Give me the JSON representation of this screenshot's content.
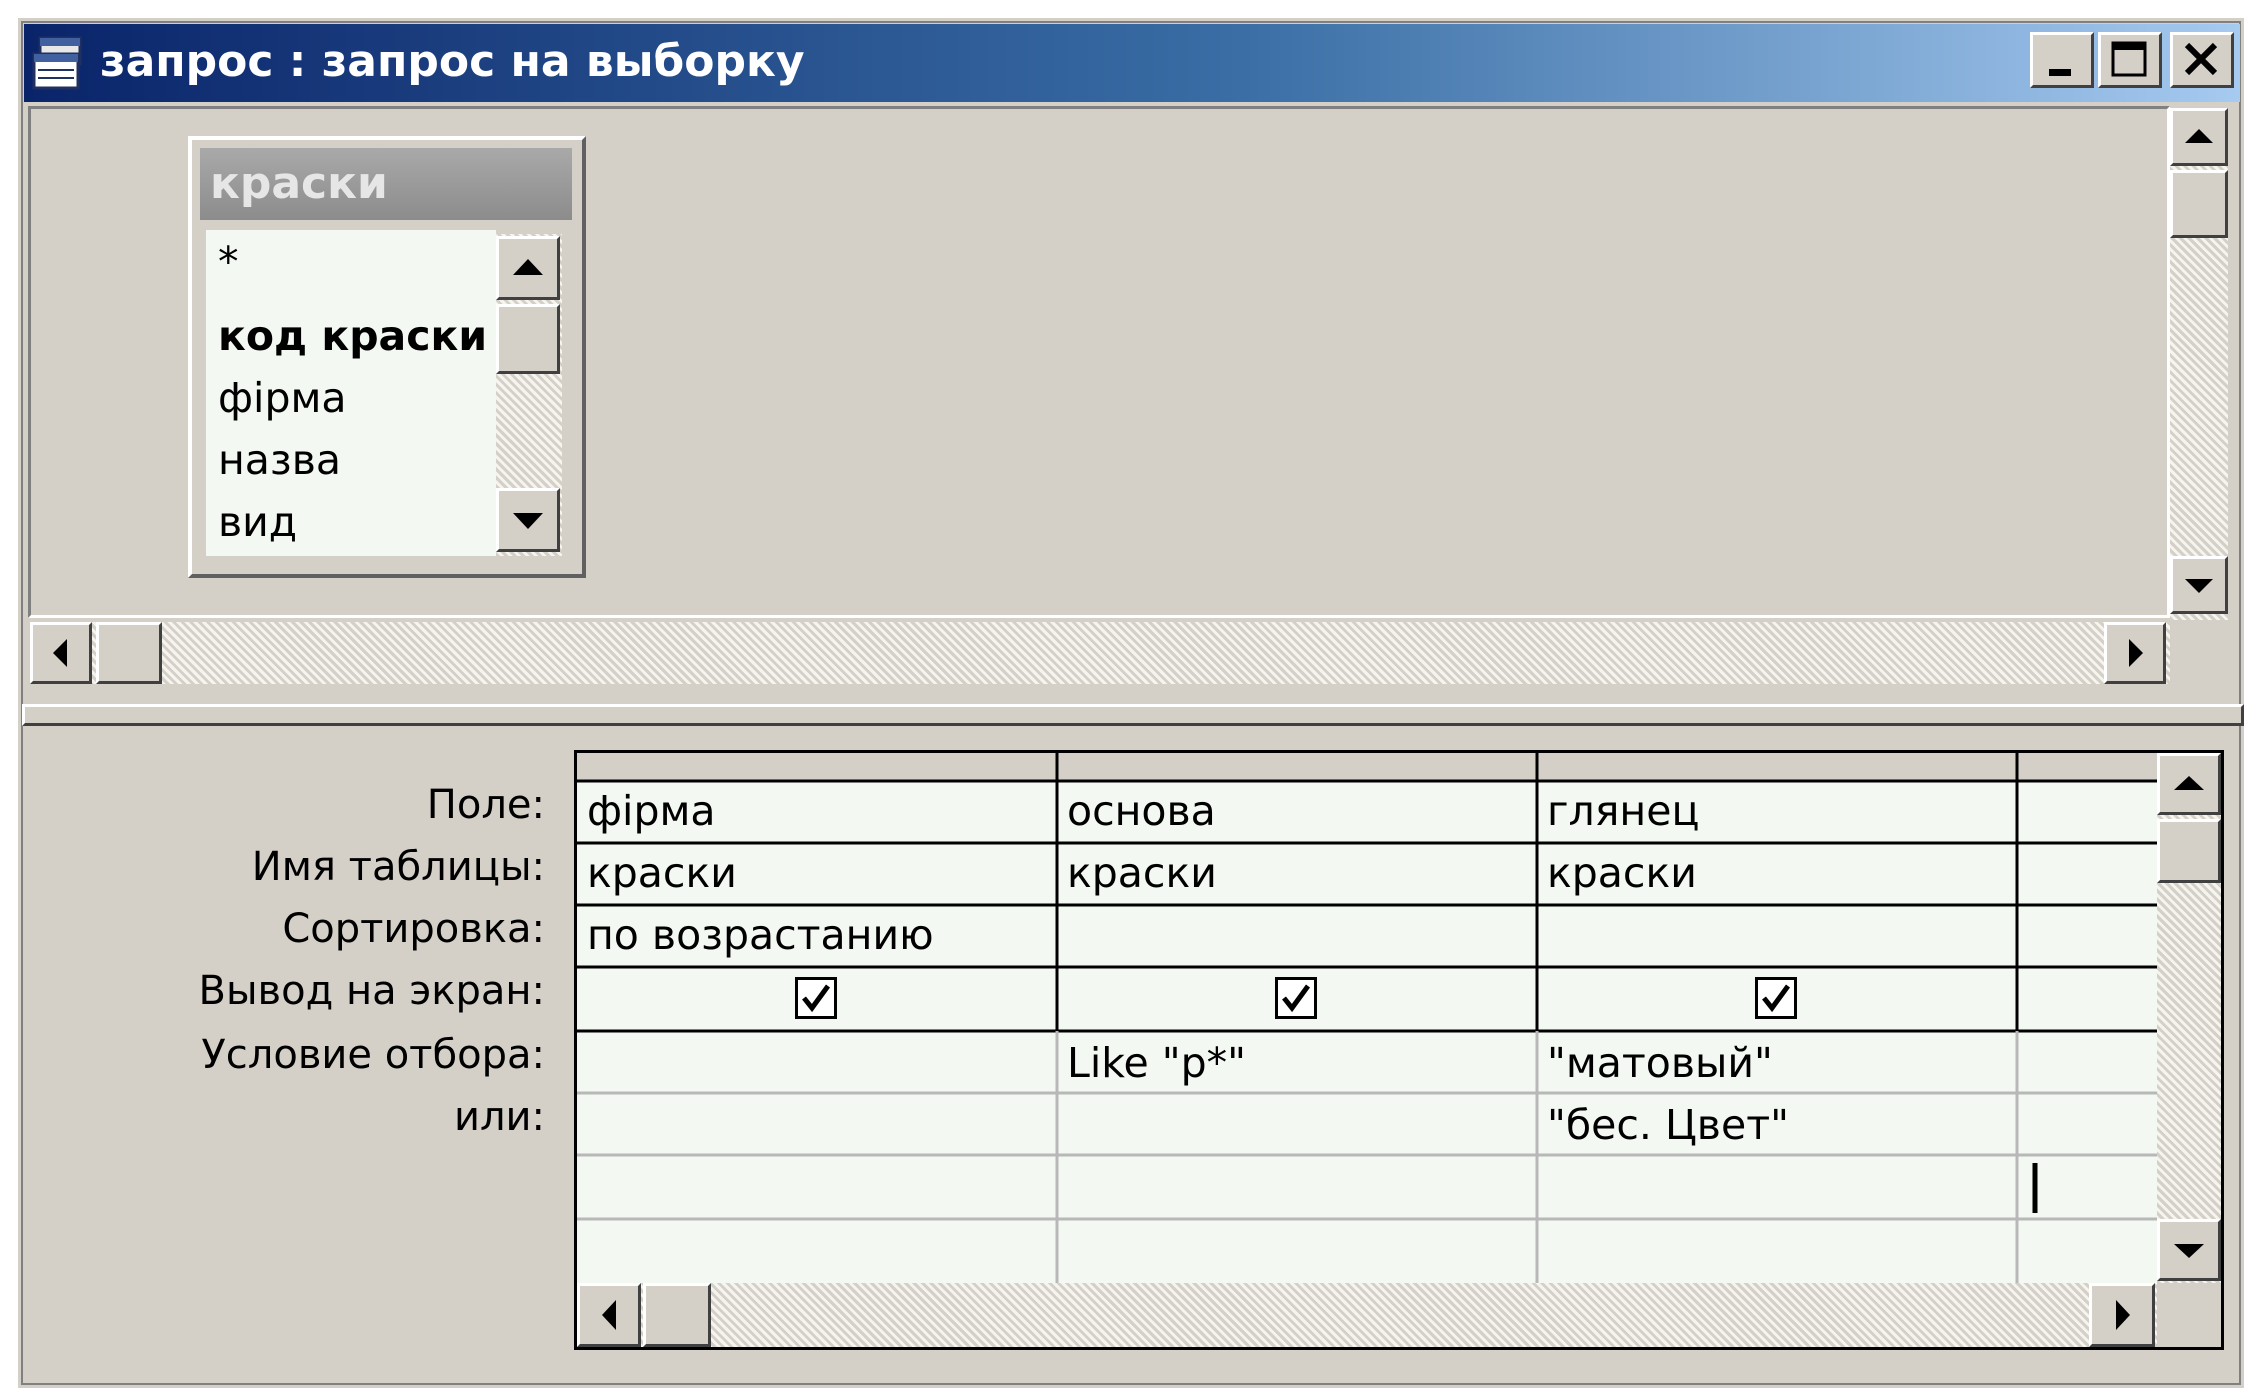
{
  "window": {
    "title": "запрос : запрос на выборку",
    "icon": "query-window-icon",
    "buttons": [
      "minimize-icon",
      "maximize-icon",
      "close-icon"
    ]
  },
  "table_box": {
    "title": "краски",
    "fields": [
      "*",
      "код краски",
      "фірма",
      "назва",
      "вид"
    ],
    "primary_key_field": "код краски"
  },
  "grid": {
    "row_labels": {
      "field": "Поле:",
      "table": "Имя таблицы:",
      "sort": "Сортировка:",
      "show": "Вывод на экран:",
      "criteria": "Условие отбора:",
      "or": "или:"
    },
    "columns": [
      {
        "field": "фірма",
        "table": "краски",
        "sort": "по возрастанию",
        "show": true,
        "criteria": "",
        "or": ""
      },
      {
        "field": "основа",
        "table": "краски",
        "sort": "",
        "show": true,
        "criteria": "Like \"p*\"",
        "or": ""
      },
      {
        "field": "глянец",
        "table": "краски",
        "sort": "",
        "show": true,
        "criteria": "\"матовый\"",
        "or": "\"бес. Цвет\""
      }
    ]
  },
  "colors": {
    "title_bar_start": "#0a246a",
    "title_bar_end": "#a6caf0",
    "window_face": "#d4d0c8",
    "grid_background": "#f3f8f3"
  }
}
